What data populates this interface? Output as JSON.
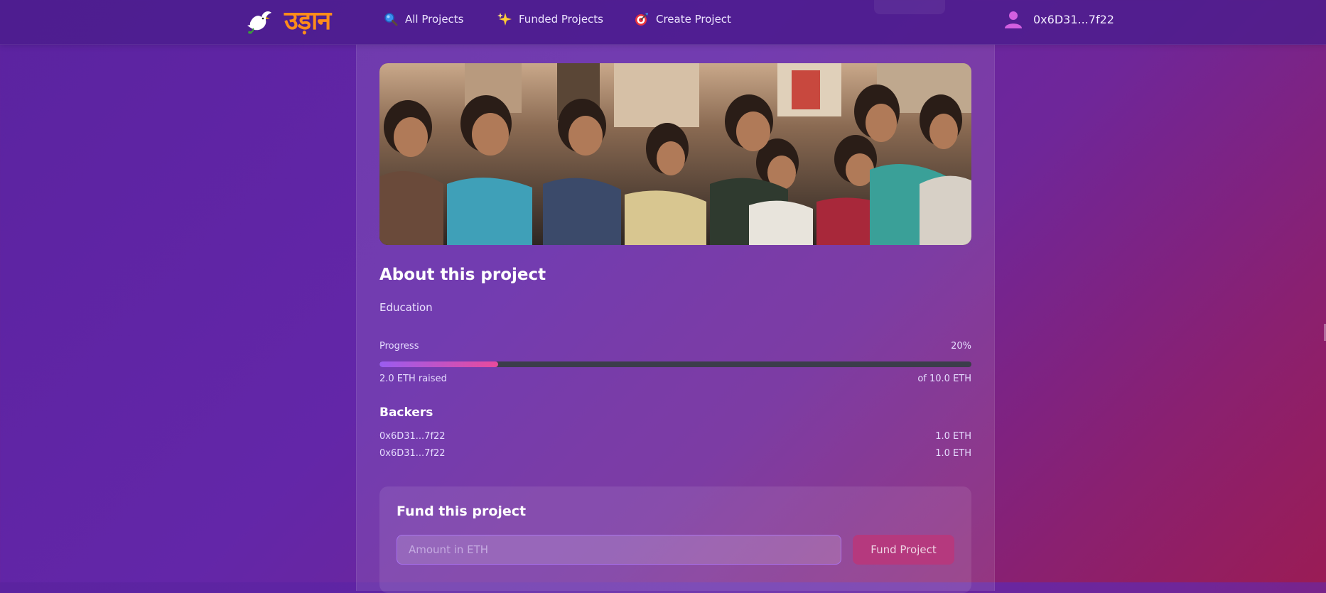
{
  "header": {
    "logo_text": "उड़ान",
    "nav": [
      {
        "label": "All Projects",
        "icon": "search-icon"
      },
      {
        "label": "Funded Projects",
        "icon": "sparkles-icon"
      },
      {
        "label": "Create Project",
        "icon": "target-icon"
      }
    ],
    "user": {
      "address": "0x6D31...7f22",
      "icon": "user-icon"
    }
  },
  "project": {
    "image_alt": "Children sitting together in a classroom",
    "about_heading": "About this project",
    "category": "Education",
    "progress": {
      "label": "Progress",
      "percent_text": "20%",
      "fraction": 0.2,
      "raised_text": "2.0 ETH raised",
      "goal_text": "of 10.0 ETH"
    },
    "backers_heading": "Backers",
    "backers": [
      {
        "address": "0x6D31...7f22",
        "amount": "1.0 ETH"
      },
      {
        "address": "0x6D31...7f22",
        "amount": "1.0 ETH"
      }
    ]
  },
  "fund": {
    "title": "Fund this project",
    "input_placeholder": "Amount in ETH",
    "input_value": "",
    "button_label": "Fund Project"
  },
  "colors": {
    "logo_text": "#ff8c1a",
    "progress_start": "#9a5cf0",
    "progress_end": "#e84a9c",
    "fund_button": "#b5397e",
    "input_border": "#b078ff"
  }
}
